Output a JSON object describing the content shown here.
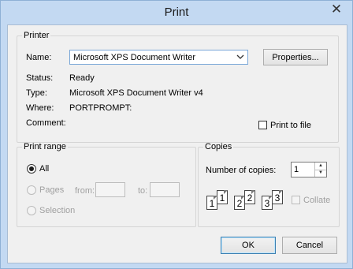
{
  "window": {
    "title": "Print",
    "close_glyph": "✕"
  },
  "printer": {
    "legend": "Printer",
    "name_label": "Name:",
    "name_value": "Microsoft XPS Document Writer",
    "properties_button": "Properties...",
    "status_label": "Status:",
    "status_value": "Ready",
    "type_label": "Type:",
    "type_value": "Microsoft XPS Document Writer v4",
    "where_label": "Where:",
    "where_value": "PORTPROMPT:",
    "comment_label": "Comment:",
    "comment_value": "",
    "print_to_file_label": "Print to file",
    "print_to_file_checked": false
  },
  "print_range": {
    "legend": "Print range",
    "all_label": "All",
    "pages_label": "Pages",
    "from_label": "from:",
    "to_label": "to:",
    "from_value": "",
    "to_value": "",
    "selection_label": "Selection",
    "selected": "All"
  },
  "copies": {
    "legend": "Copies",
    "number_label": "Number of copies:",
    "number_value": "1",
    "collate_label": "Collate",
    "collate_checked": false,
    "collate_icon_digits": [
      "1",
      "1",
      "2",
      "2",
      "3",
      "3"
    ]
  },
  "buttons": {
    "ok": "OK",
    "cancel": "Cancel"
  },
  "icons": {
    "dropdown": "chevron-down-icon",
    "spin_up": "spin-up-icon",
    "spin_down": "spin-down-icon"
  }
}
